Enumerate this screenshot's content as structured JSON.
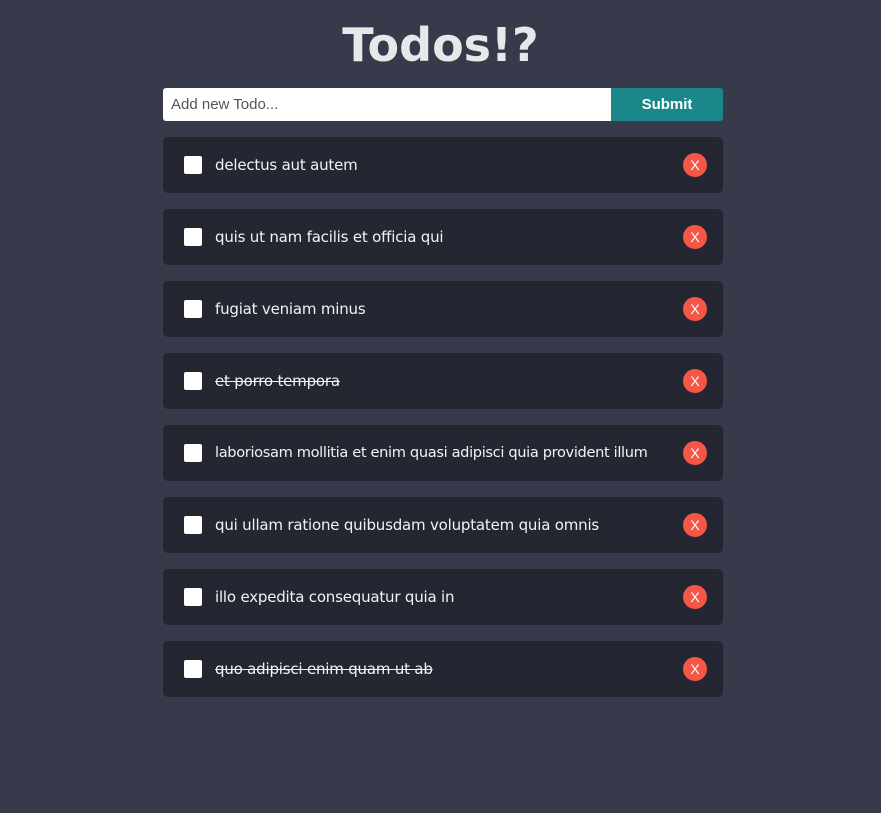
{
  "app": {
    "title": "Todos!?"
  },
  "form": {
    "input_value": "",
    "input_placeholder": "Add new Todo...",
    "submit_label": "Submit"
  },
  "todos": [
    {
      "text": "delectus aut autem",
      "completed": false,
      "delete_label": "X"
    },
    {
      "text": "quis ut nam facilis et officia qui",
      "completed": false,
      "delete_label": "X"
    },
    {
      "text": "fugiat veniam minus",
      "completed": false,
      "delete_label": "X"
    },
    {
      "text": "et porro tempora",
      "completed": true,
      "delete_label": "X"
    },
    {
      "text": "laboriosam mollitia et enim quasi adipisci quia provident illum",
      "completed": false,
      "delete_label": "X"
    },
    {
      "text": "qui ullam ratione quibusdam voluptatem quia omnis",
      "completed": false,
      "delete_label": "X"
    },
    {
      "text": "illo expedita consequatur quia in",
      "completed": false,
      "delete_label": "X"
    },
    {
      "text": "quo adipisci enim quam ut ab",
      "completed": true,
      "delete_label": "X"
    }
  ],
  "colors": {
    "background": "#363a4a",
    "card": "#242731",
    "submit_button": "#1c878a",
    "delete_button": "#f55747",
    "checkbox": "#ffffff"
  },
  "icons": {
    "checkbox": "checkbox-icon",
    "delete": "close-icon"
  }
}
